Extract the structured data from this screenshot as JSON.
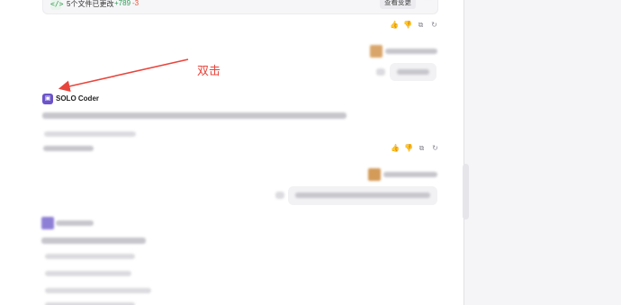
{
  "changes": {
    "code_icon": "</>",
    "summary": "5个文件已更改",
    "added": "+789",
    "removed": "-3",
    "view_button": "查看变更",
    "toggle_icon": "chevron-up-down"
  },
  "message_actions": [
    "👍",
    "👎",
    "⧉",
    "↻"
  ],
  "agent": {
    "icon_text": "▣",
    "name": "SOLO Coder"
  },
  "annotation": {
    "text": "双击",
    "color": "#e8453c"
  },
  "colors": {
    "agent_accent": "#6b54c9",
    "added": "#2f9e57",
    "removed": "#e2553b"
  }
}
